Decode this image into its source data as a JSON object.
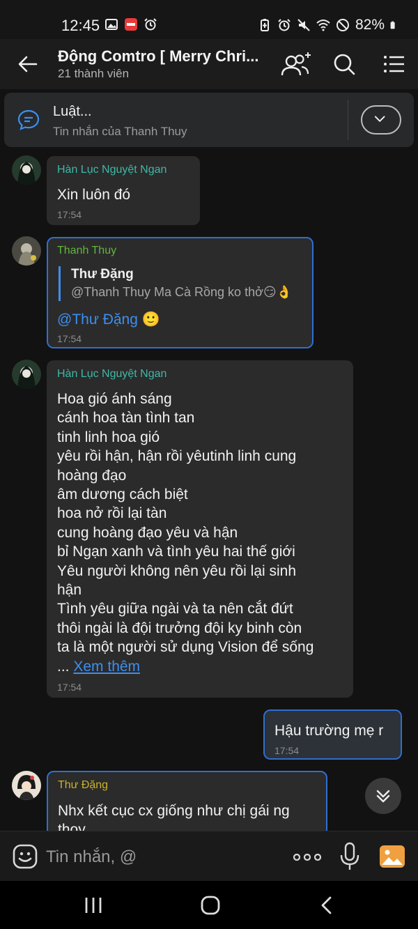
{
  "status_bar": {
    "time": "12:45",
    "battery": "82%",
    "left_icons": [
      "gallery-icon",
      "manga-app-icon",
      "alarm-icon"
    ],
    "right_icons": [
      "battery-saver-icon",
      "alarm-icon",
      "mute-icon",
      "wifi-icon",
      "no-data-icon",
      "battery-icon"
    ]
  },
  "header": {
    "title": "Động Comtro [ Merry Chri...",
    "subtitle": "21 thành viên"
  },
  "pinned": {
    "title": "Luật...",
    "subtitle": "Tin nhắn của Thanh Thuy"
  },
  "messages": [
    {
      "sender": "Hàn Lục Nguyệt Ngan",
      "sender_color": "#3fb8a8",
      "text": "Xin luôn đó",
      "time": "17:54"
    },
    {
      "sender": "Thanh Thuy",
      "sender_color": "#5fb83a",
      "quote_name": "Thư Đặng",
      "quote_text": "@Thanh Thuy Ma Cà Rồng ko thở😏👌",
      "mention": "@Thư Đặng",
      "emoji": "🙂",
      "time": "17:54"
    },
    {
      "sender": "Hàn Lục Nguyệt Ngan",
      "sender_color": "#3fb8a8",
      "text": "Hoa gió ánh sáng\ncánh hoa tàn tình tan\ntinh linh hoa gió\nyêu rồi hận, hận rồi yêutinh linh cung\nhoàng đạo\nâm dương cách biệt\nhoa nở rồi lại tàn\ncung hoàng đạo yêu và hận\nbỉ Ngạn xanh và tình yêu hai thế giới\nYêu người không nên yêu rồi lại sinh\nhận\nTình yêu giữa ngài và ta nên cắt đứt\nthôi ngài là đội trưởng đội ky binh còn\nta là một người sử dụng Vision để sống",
      "ellipsis": "... ",
      "see_more": "Xem thêm",
      "time": "17:54"
    },
    {
      "sender": "",
      "text": "Hậu trường mẹ r",
      "time": "17:54",
      "outgoing": true
    },
    {
      "sender": "Thư Đặng",
      "sender_color": "#c9b22a",
      "text": "Nhx kết cục cx giống như chị gái ng\nthoy"
    }
  ],
  "composer": {
    "placeholder": "Tin nhắn, @"
  },
  "colors": {
    "accent": "#3d8ff0",
    "bubble": "#2b2b2b",
    "outgoing_bubble": "#2d3138",
    "background": "#121212"
  }
}
